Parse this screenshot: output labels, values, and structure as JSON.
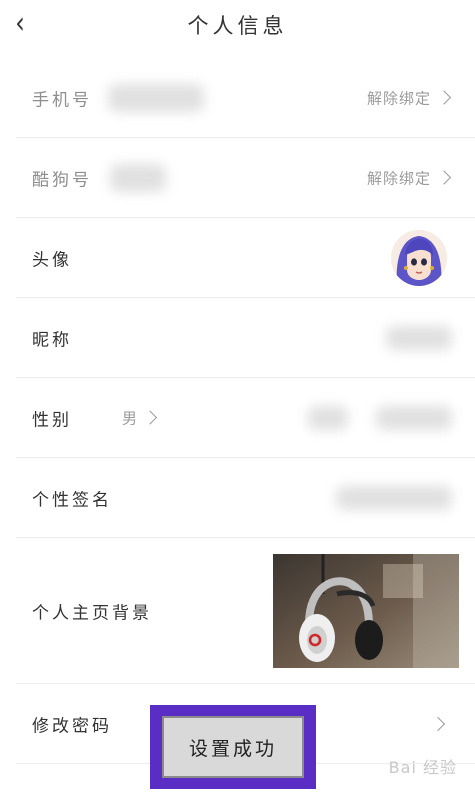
{
  "header": {
    "title": "个人信息",
    "back_icon": "chevron-left-icon"
  },
  "rows": {
    "phone": {
      "label": "手机号",
      "action": "解除绑定"
    },
    "kugou": {
      "label": "酷狗号",
      "action": "解除绑定"
    },
    "avatar": {
      "label": "头像"
    },
    "nickname": {
      "label": "昵称"
    },
    "gender": {
      "label": "性别",
      "value": "男"
    },
    "signature": {
      "label": "个性签名"
    },
    "background": {
      "label": "个人主页背景"
    },
    "password": {
      "label": "修改密码"
    }
  },
  "toast": {
    "message": "设置成功",
    "accent": "#5a2ec4"
  },
  "watermark": {
    "text": "Bai 经验"
  }
}
